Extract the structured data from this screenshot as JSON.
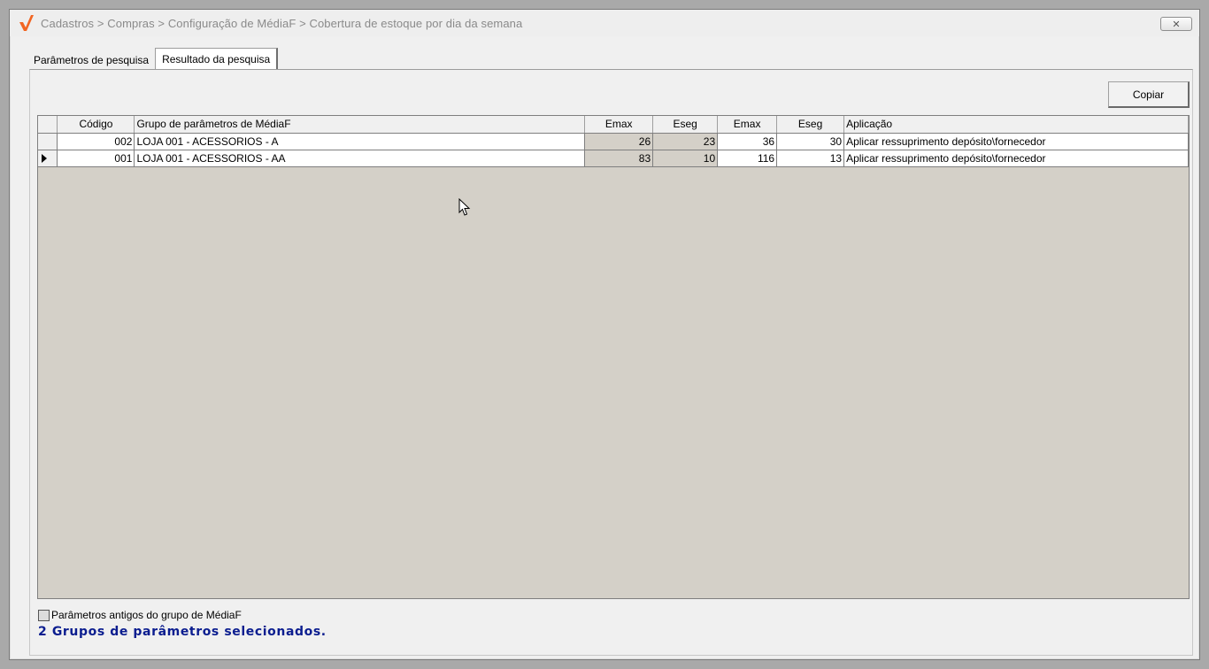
{
  "window": {
    "title": "Cadastros > Compras > Configuração de MédiaF > Cobertura de estoque por dia da semana",
    "close_glyph": "✕",
    "logo_icon": "checkmark-logo",
    "accent_color": "#f26522"
  },
  "tabs": [
    {
      "label": "Parâmetros de pesquisa",
      "active": false
    },
    {
      "label": "Resultado da pesquisa",
      "active": true
    }
  ],
  "toolbar": {
    "copy_label": "Copiar"
  },
  "grid": {
    "headers": [
      "",
      "Código",
      "Grupo de parâmetros de MédiaF",
      "Emax",
      "Eseg",
      "Emax",
      "Eseg",
      "Aplicação"
    ],
    "rows": [
      {
        "selected": false,
        "codigo": "002",
        "grupo": "LOJA 001 - ACESSORIOS - A",
        "emax1": "26",
        "eseg1": "23",
        "emax2": "36",
        "eseg2": "30",
        "aplicacao": "Aplicar ressuprimento depósito\\fornecedor"
      },
      {
        "selected": true,
        "codigo": "001",
        "grupo": "LOJA 001 - ACESSORIOS - AA",
        "emax1": "83",
        "eseg1": "10",
        "emax2": "116",
        "eseg2": "13",
        "aplicacao": "Aplicar ressuprimento depósito\\fornecedor"
      }
    ]
  },
  "footer": {
    "checkbox_label": "Parâmetros antigos do grupo de MédiaF",
    "checkbox_checked": false,
    "status": "2 Grupos de parâmetros selecionados.",
    "status_color": "#0b1d8f"
  }
}
